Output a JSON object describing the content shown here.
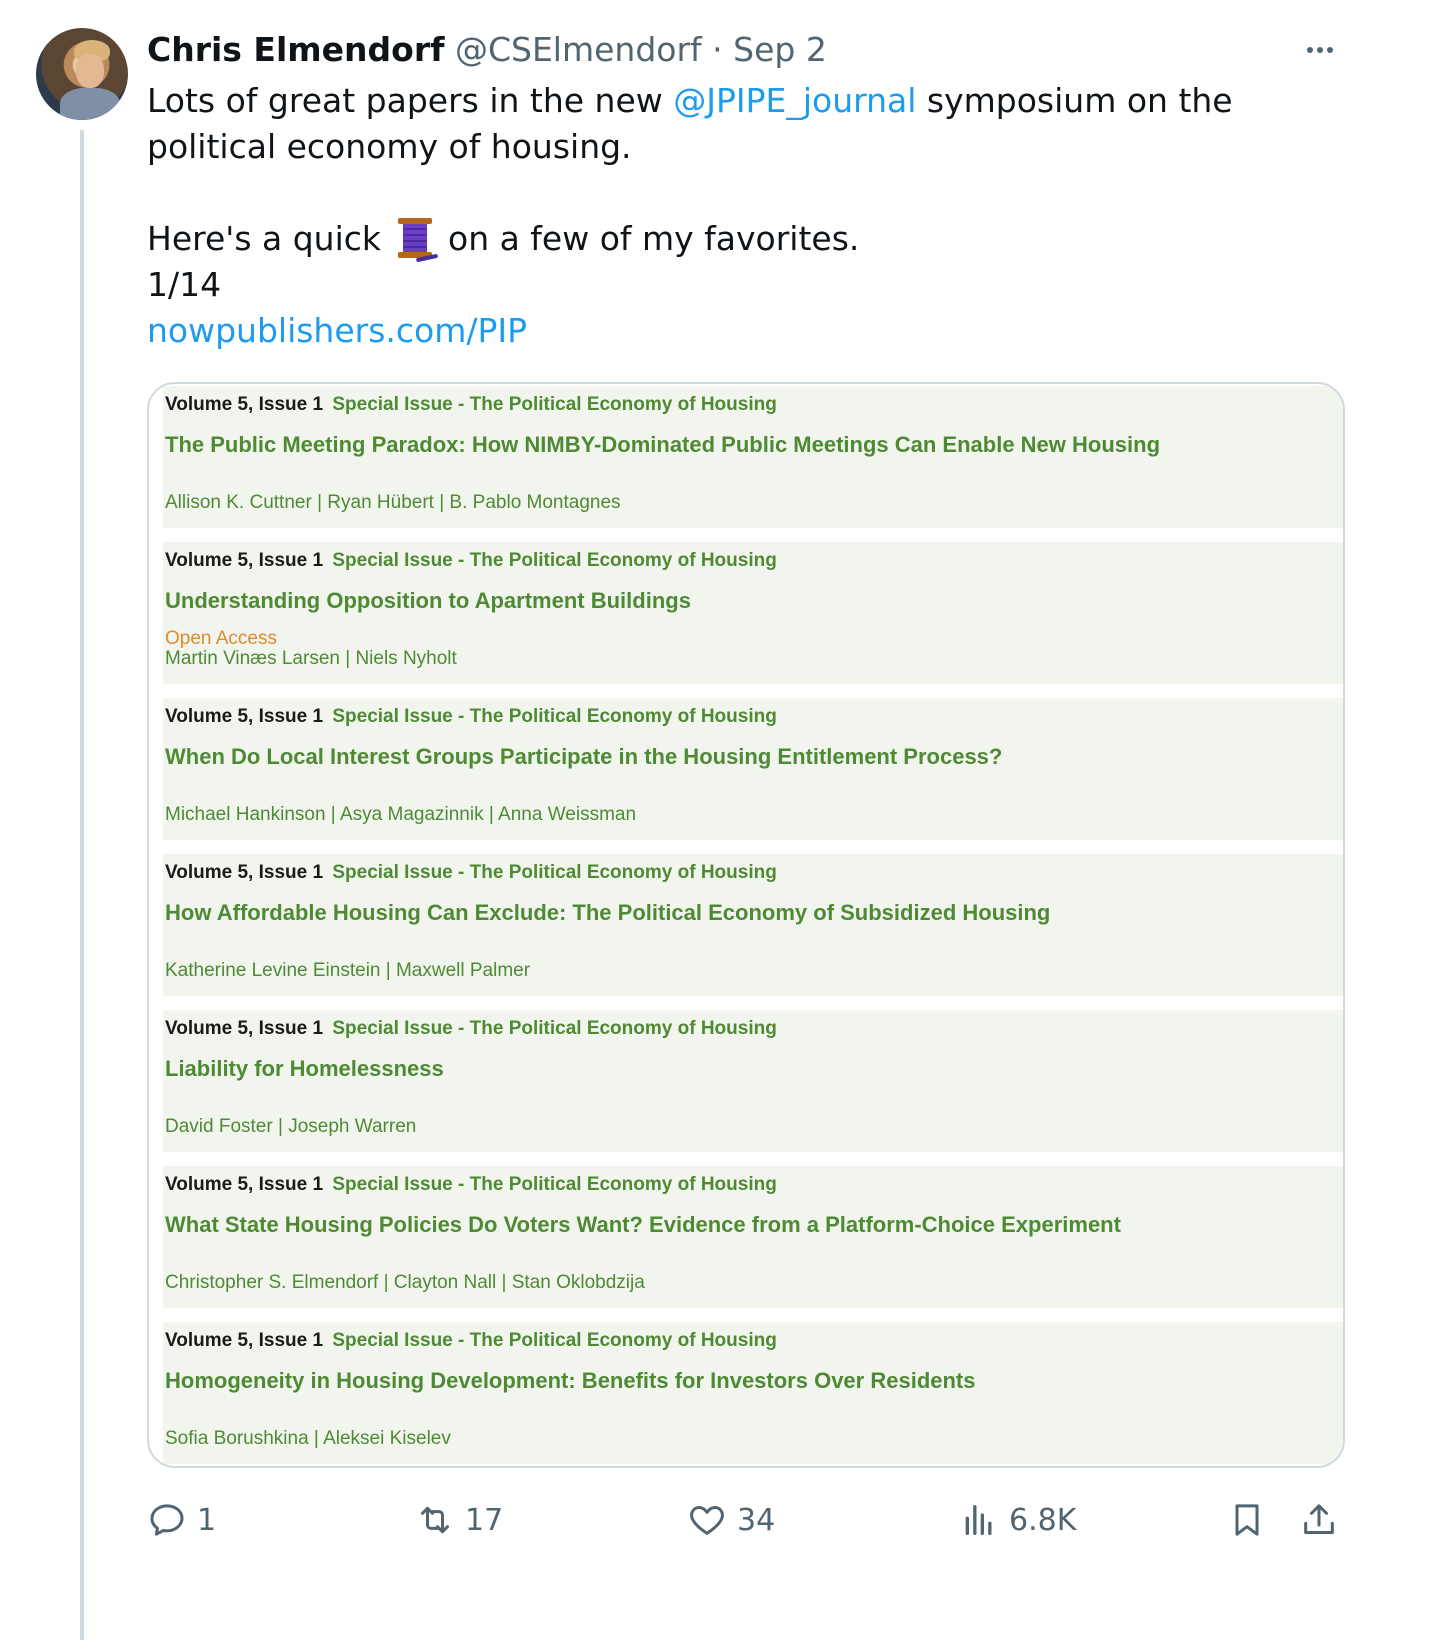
{
  "tweet": {
    "author_name": "Chris Elmendorf",
    "handle": "@CSElmendorf",
    "separator": "·",
    "date": "Sep 2",
    "text_line1_before": "Lots of great papers in the new ",
    "mention": "@JPIPE_journal",
    "text_line1_after": " symposium on the political economy of housing.",
    "text_line2_before": "Here's a quick ",
    "text_line2_after": " on a few of my favorites.",
    "counter": "1/14",
    "link": "nowpublishers.com/PIP"
  },
  "card": {
    "entries": [
      {
        "volume": "Volume 5, Issue 1",
        "special": "Special Issue - The Political Economy of Housing",
        "title": "The Public Meeting Paradox: How NIMBY-Dominated Public Meetings Can Enable New Housing",
        "open_access": "",
        "authors": "Allison K. Cuttner | Ryan Hübert | B. Pablo Montagnes"
      },
      {
        "volume": "Volume 5, Issue 1",
        "special": "Special Issue - The Political Economy of Housing",
        "title": "Understanding Opposition to Apartment Buildings",
        "open_access": "Open Access",
        "authors": "Martin Vinæs Larsen | Niels Nyholt"
      },
      {
        "volume": "Volume 5, Issue 1",
        "special": "Special Issue - The Political Economy of Housing",
        "title": "When Do Local Interest Groups Participate in the Housing Entitlement Process?",
        "open_access": "",
        "authors": "Michael Hankinson | Asya Magazinnik | Anna Weissman"
      },
      {
        "volume": "Volume 5, Issue 1",
        "special": "Special Issue - The Political Economy of Housing",
        "title": "How Affordable Housing Can Exclude: The Political Economy of Subsidized Housing",
        "open_access": "",
        "authors": "Katherine Levine Einstein | Maxwell Palmer"
      },
      {
        "volume": "Volume 5, Issue 1",
        "special": "Special Issue - The Political Economy of Housing",
        "title": "Liability for Homelessness",
        "open_access": "",
        "authors": "David Foster | Joseph Warren"
      },
      {
        "volume": "Volume 5, Issue 1",
        "special": "Special Issue - The Political Economy of Housing",
        "title": "What State Housing Policies Do Voters Want? Evidence from a Platform-Choice Experiment",
        "open_access": "",
        "authors": "Christopher S. Elmendorf | Clayton Nall | Stan Oklobdzija"
      },
      {
        "volume": "Volume 5, Issue 1",
        "special": "Special Issue - The Political Economy of Housing",
        "title": "Homogeneity in Housing Development: Benefits for Investors Over Residents",
        "open_access": "",
        "authors": "Sofia Borushkina | Aleksei Kiselev"
      }
    ]
  },
  "actions": {
    "replies": "1",
    "retweets": "17",
    "likes": "34",
    "views": "6.8K"
  },
  "icons": {
    "reply": "reply-icon",
    "retweet": "retweet-icon",
    "like": "heart-icon",
    "views": "analytics-icon",
    "bookmark": "bookmark-icon",
    "share": "share-icon",
    "more": "more-icon",
    "thread": "spool-of-thread-icon"
  },
  "colors": {
    "link": "#1d9bf0",
    "muted": "#536471",
    "card_green": "#4e8a34",
    "open_access": "#e08a2c"
  }
}
